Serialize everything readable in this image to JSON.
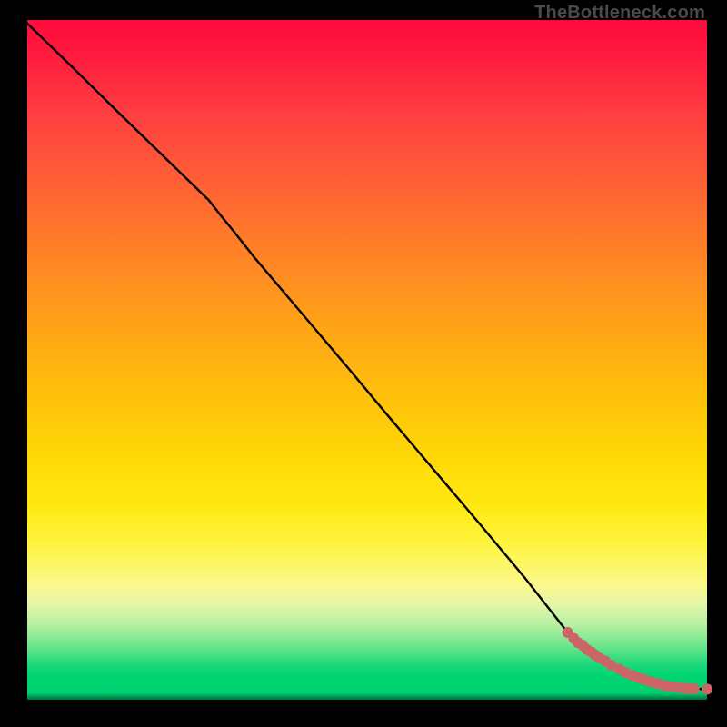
{
  "watermark": "TheBottleneck.com",
  "chart_data": {
    "type": "line",
    "title": "",
    "xlabel": "",
    "ylabel": "",
    "xlim": [
      0,
      100
    ],
    "ylim": [
      0,
      100
    ],
    "grid": false,
    "legend": false,
    "line": {
      "x": [
        0,
        6.7,
        13.3,
        20.0,
        26.7,
        28.5,
        30.3,
        33.3,
        40.0,
        46.7,
        53.3,
        60.0,
        66.7,
        73.3,
        79.5,
        80.0,
        81.7,
        83.3,
        85.0,
        86.7,
        88.3,
        90.0,
        91.7,
        93.3,
        95.0,
        96.7,
        98.3,
        100
      ],
      "y": [
        99.5,
        93.0,
        86.5,
        80.0,
        73.5,
        71.2,
        69.0,
        65.2,
        57.3,
        49.4,
        41.5,
        33.6,
        25.7,
        17.8,
        9.9,
        9.3,
        8.0,
        6.8,
        5.7,
        4.7,
        3.9,
        3.2,
        2.6,
        2.2,
        1.9,
        1.7,
        1.6,
        1.55
      ]
    },
    "scatter": {
      "x": [
        79.5,
        80.4,
        81.0,
        81.7,
        82.3,
        83.0,
        83.5,
        84.2,
        85.0,
        85.9,
        87.1,
        88.0,
        89.0,
        90.0,
        90.9,
        91.8,
        92.6,
        93.4,
        94.2,
        95.1,
        96.0,
        96.8,
        97.4,
        98.1,
        100.0
      ],
      "y": [
        9.9,
        9.0,
        8.4,
        8.0,
        7.4,
        7.0,
        6.6,
        6.1,
        5.7,
        5.1,
        4.5,
        4.0,
        3.6,
        3.2,
        2.9,
        2.6,
        2.4,
        2.2,
        2.0,
        1.9,
        1.8,
        1.7,
        1.6,
        1.6,
        1.55
      ],
      "color": "#cc6666",
      "marker_radius_px": 6
    },
    "colors": {
      "line": "#000000",
      "background_gradient_top": "#ff0a3c",
      "background_gradient_bottom": "#00d170",
      "scatter": "#cc6666"
    }
  }
}
